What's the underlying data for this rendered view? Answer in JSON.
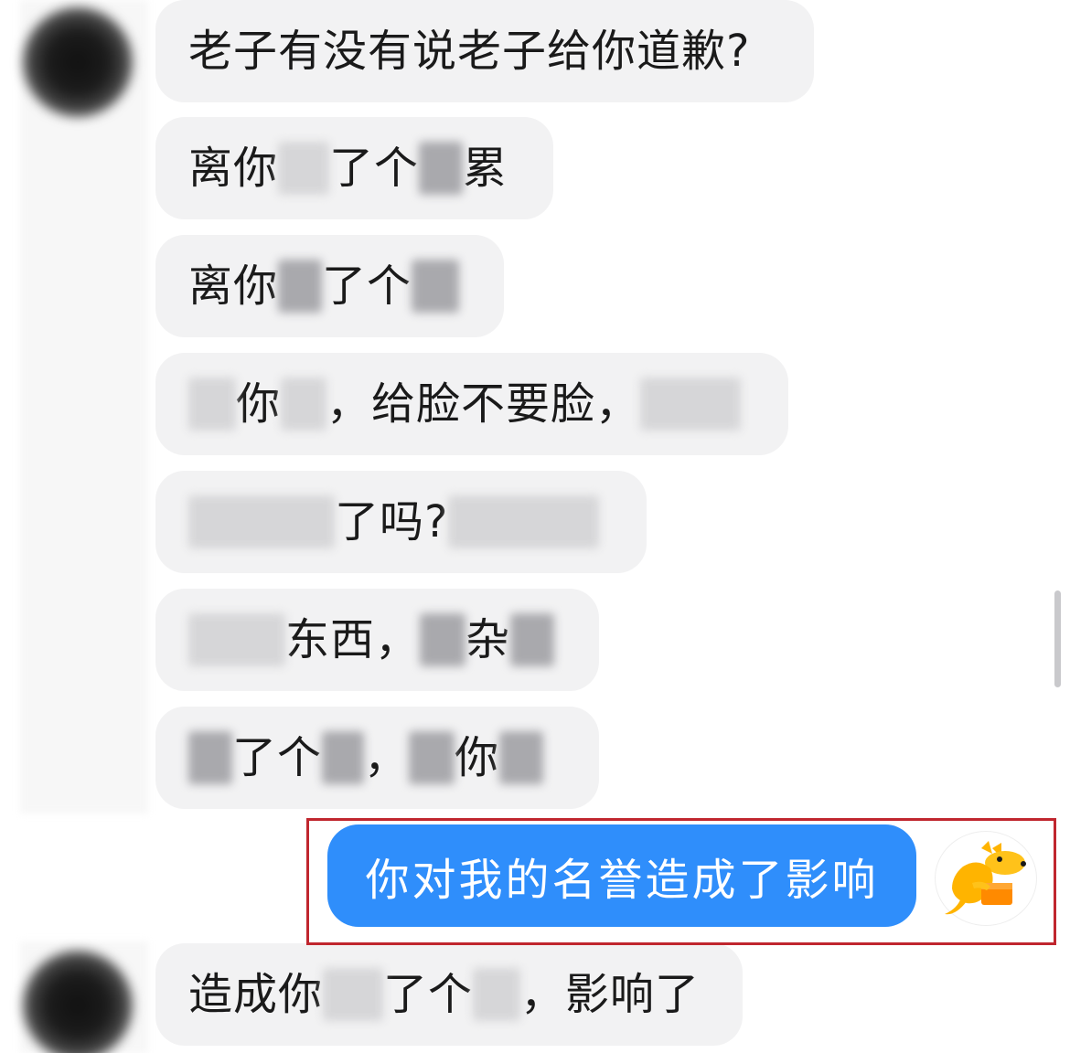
{
  "messages": [
    {
      "segments": [
        {
          "t": "text",
          "v": "老子有没有说老子给你道歉?"
        }
      ]
    },
    {
      "segments": [
        {
          "t": "text",
          "v": "离你"
        },
        {
          "t": "blur",
          "w": 56
        },
        {
          "t": "text",
          "v": "了个"
        },
        {
          "t": "blur",
          "w": 48,
          "dark": true
        },
        {
          "t": "text",
          "v": "累"
        }
      ]
    },
    {
      "segments": [
        {
          "t": "text",
          "v": "离你"
        },
        {
          "t": "blur",
          "w": 48,
          "dark": true
        },
        {
          "t": "text",
          "v": "了个"
        },
        {
          "t": "blur",
          "w": 52,
          "dark": true
        }
      ]
    },
    {
      "segments": [
        {
          "t": "blur",
          "w": 52
        },
        {
          "t": "text",
          "v": "你"
        },
        {
          "t": "blur",
          "w": 50
        },
        {
          "t": "text",
          "v": "，给脸不要脸，"
        },
        {
          "t": "blur",
          "w": 110
        }
      ]
    },
    {
      "segments": [
        {
          "t": "blur",
          "w": 160
        },
        {
          "t": "text",
          "v": "了吗?"
        },
        {
          "t": "blur",
          "w": 165
        }
      ]
    },
    {
      "segments": [
        {
          "t": "blur",
          "w": 106
        },
        {
          "t": "text",
          "v": "东西，"
        },
        {
          "t": "blur",
          "w": 50,
          "dark": true
        },
        {
          "t": "text",
          "v": "杂"
        },
        {
          "t": "blur",
          "w": 48,
          "dark": true
        }
      ]
    },
    {
      "segments": [
        {
          "t": "blur",
          "w": 48,
          "dark": true
        },
        {
          "t": "text",
          "v": "了个"
        },
        {
          "t": "blur",
          "w": 46,
          "dark": true
        },
        {
          "t": "text",
          "v": "，"
        },
        {
          "t": "blur",
          "w": 50,
          "dark": true
        },
        {
          "t": "text",
          "v": "你"
        },
        {
          "t": "blur",
          "w": 48,
          "dark": true
        }
      ]
    },
    {
      "segments": [
        {
          "t": "text",
          "v": "造成你"
        },
        {
          "t": "blur",
          "w": 66
        },
        {
          "t": "text",
          "v": "了个"
        },
        {
          "t": "blur",
          "w": 52
        },
        {
          "t": "text",
          "v": "，影响了"
        }
      ]
    }
  ],
  "my_message": "你对我的名誉造成了影响",
  "colors": {
    "my_bubble": "#2f8efb",
    "other_bubble": "#f2f2f3",
    "highlight": "#c0262e"
  },
  "icons": {
    "my_avatar": "yellow-kangaroo-delivery-icon"
  }
}
